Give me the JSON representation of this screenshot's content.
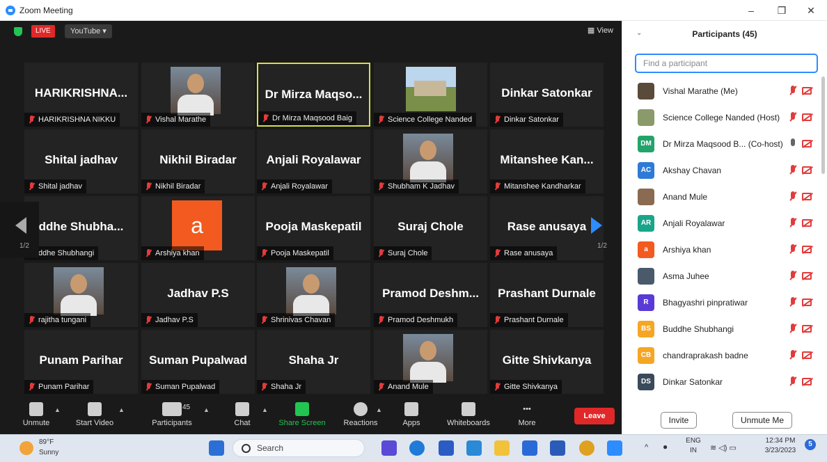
{
  "window": {
    "title": "Zoom Meeting",
    "minimize": "–",
    "restore": "❐",
    "close": "✕"
  },
  "topbar": {
    "live": "LIVE",
    "youtube": "YouTube ▾",
    "view": "▦ View"
  },
  "gallery": {
    "page_left": "1/2",
    "page_right": "1/2",
    "tiles": [
      {
        "big": "HARIKRISHNA...",
        "name": "HARIKRISHNA NIKKU"
      },
      {
        "big": "",
        "name": "Vishal Marathe",
        "photo": "person-photo"
      },
      {
        "big": "Dr Mirza Maqso...",
        "name": "Dr Mirza Maqsood Baig",
        "active": true
      },
      {
        "big": "",
        "name": "Science College Nanded",
        "photo": "building-photo"
      },
      {
        "big": "Dinkar Satonkar",
        "name": "Dinkar Satonkar"
      },
      {
        "big": "Shital jadhav",
        "name": "Shital jadhav"
      },
      {
        "big": "Nikhil Biradar",
        "name": "Nikhil Biradar"
      },
      {
        "big": "Anjali Royalawar",
        "name": "Anjali Royalawar"
      },
      {
        "big": "",
        "name": "Shubham K Jadhav",
        "photo": "person-photo"
      },
      {
        "big": "Mitanshee Kan...",
        "name": "Mitanshee Kandharkar"
      },
      {
        "big": "ddhe Shubha...",
        "name": "ddhe Shubhangi"
      },
      {
        "big": "",
        "name": "Arshiya khan",
        "avatar_letter": "a"
      },
      {
        "big": "Pooja Maskepatil",
        "name": "Pooja Maskepatil"
      },
      {
        "big": "Suraj Chole",
        "name": "Suraj Chole"
      },
      {
        "big": "Rase anusaya",
        "name": "Rase anusaya"
      },
      {
        "big": "",
        "name": "rajitha tungani",
        "photo": "person-photo"
      },
      {
        "big": "Jadhav P.S",
        "name": "Jadhav P.S"
      },
      {
        "big": "",
        "name": "Shrinivas Chavan",
        "photo": "person-photo"
      },
      {
        "big": "Pramod Deshm...",
        "name": "Pramod Deshmukh"
      },
      {
        "big": "Prashant Durnale",
        "name": "Prashant Durnale"
      },
      {
        "big": "Punam Parihar",
        "name": "Punam Parihar"
      },
      {
        "big": "Suman Pupalwad",
        "name": "Suman Pupalwad"
      },
      {
        "big": "Shaha Jr",
        "name": "Shaha Jr"
      },
      {
        "big": "",
        "name": "Anand Mule",
        "photo": "person-photo"
      },
      {
        "big": "Gitte Shivkanya",
        "name": "Gitte Shivkanya"
      }
    ]
  },
  "toolbar": {
    "unmute": "Unmute",
    "start_video": "Start Video",
    "participants": "Participants",
    "participants_count": "45",
    "chat": "Chat",
    "share_screen": "Share Screen",
    "reactions": "Reactions",
    "apps": "Apps",
    "whiteboards": "Whiteboards",
    "more": "More",
    "leave": "Leave"
  },
  "panel": {
    "title": "Participants (45)",
    "search_placeholder": "Find a participant",
    "invite": "Invite",
    "unmute_me": "Unmute Me",
    "participants": [
      {
        "name": "Vishal Marathe (Me)",
        "initials": "",
        "color": "#5a4a3a",
        "mic": "off"
      },
      {
        "name": "Science College Nanded (Host)",
        "initials": "",
        "color": "#8a9a6a",
        "mic": "off"
      },
      {
        "name": "Dr Mirza Maqsood B... (Co-host)",
        "initials": "DM",
        "color": "#23a36b",
        "mic": "on"
      },
      {
        "name": "Akshay Chavan",
        "initials": "AC",
        "color": "#2d7bd6",
        "mic": "off"
      },
      {
        "name": "Anand Mule",
        "initials": "",
        "color": "#8a6a50",
        "mic": "off"
      },
      {
        "name": "Anjali Royalawar",
        "initials": "AR",
        "color": "#1aa58a",
        "mic": "off"
      },
      {
        "name": "Arshiya khan",
        "initials": "a",
        "color": "#f25a1f",
        "mic": "off"
      },
      {
        "name": "Asma Juhee",
        "initials": "",
        "color": "#4a5a6a",
        "mic": "off"
      },
      {
        "name": "Bhagyashri pinpratiwar",
        "initials": "R",
        "color": "#5a3ad6",
        "mic": "off"
      },
      {
        "name": "Buddhe Shubhangi",
        "initials": "BS",
        "color": "#f5a623",
        "mic": "off"
      },
      {
        "name": "chandraprakash badne",
        "initials": "CB",
        "color": "#f5a623",
        "mic": "off"
      },
      {
        "name": "Dinkar Satonkar",
        "initials": "DS",
        "color": "#3a4a5a",
        "mic": "off"
      }
    ]
  },
  "taskbar": {
    "weather_temp": "89°F",
    "weather_cond": "Sunny",
    "search": "Search",
    "lang1": "ENG",
    "lang2": "IN",
    "time": "12:34 PM",
    "date": "3/23/2023",
    "notifications": "5"
  }
}
